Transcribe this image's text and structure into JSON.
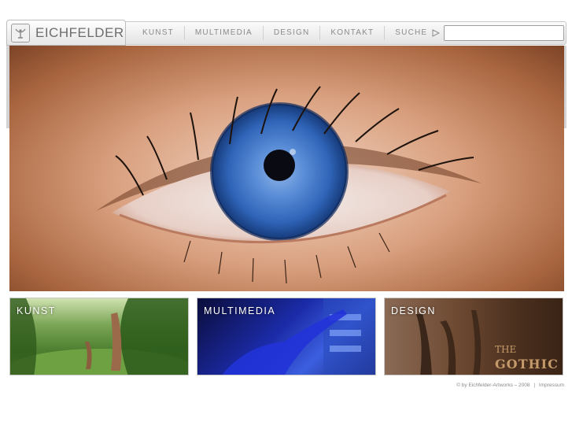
{
  "logo": {
    "text": "EICHFELDER"
  },
  "nav": {
    "items": [
      "KUNST",
      "MULTIMEDIA",
      "DESIGN",
      "KONTAKT"
    ],
    "search_label": "SUCHE",
    "search_value": ""
  },
  "tiles": [
    {
      "label": "KUNST"
    },
    {
      "label": "MULTIMEDIA"
    },
    {
      "label": "DESIGN",
      "overlay_line1": "THE",
      "overlay_line2": "GOTHIC"
    }
  ],
  "footer": {
    "copyright": "© by Eichfelder-Artworks – 2008",
    "imprint": "Impressum"
  }
}
